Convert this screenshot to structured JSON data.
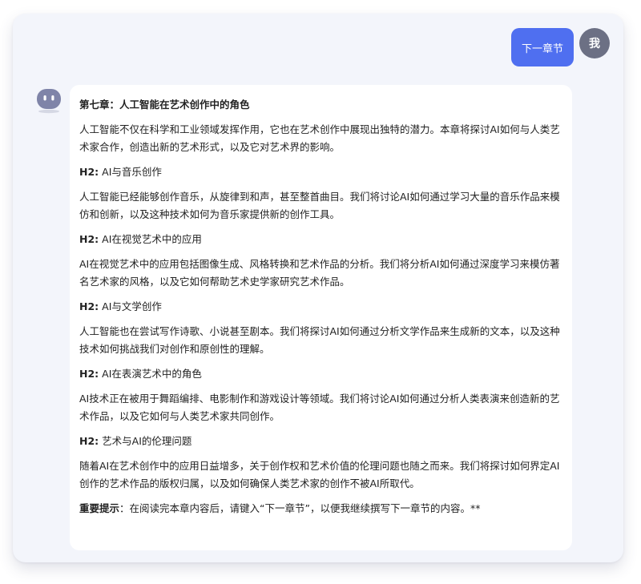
{
  "user": {
    "message": "下一章节",
    "avatar_label": "我"
  },
  "bot": {
    "avatar_icon": "robot-face-icon"
  },
  "reply": {
    "title": "第七章：人工智能在艺术创作中的角色",
    "intro": "人工智能不仅在科学和工业领域发挥作用，它也在艺术创作中展现出独特的潜力。本章将探讨AI如何与人类艺术家合作，创造出新的艺术形式，以及它对艺术界的影响。",
    "sections": [
      {
        "h2_prefix": "H2:",
        "heading": "AI与音乐创作",
        "body": "人工智能已经能够创作音乐，从旋律到和声，甚至整首曲目。我们将讨论AI如何通过学习大量的音乐作品来模仿和创新，以及这种技术如何为音乐家提供新的创作工具。"
      },
      {
        "h2_prefix": "H2:",
        "heading": "AI在视觉艺术中的应用",
        "body": "AI在视觉艺术中的应用包括图像生成、风格转换和艺术作品的分析。我们将分析AI如何通过深度学习来模仿著名艺术家的风格，以及它如何帮助艺术史学家研究艺术作品。"
      },
      {
        "h2_prefix": "H2:",
        "heading": "AI与文学创作",
        "body": "人工智能也在尝试写作诗歌、小说甚至剧本。我们将探讨AI如何通过分析文学作品来生成新的文本，以及这种技术如何挑战我们对创作和原创性的理解。"
      },
      {
        "h2_prefix": "H2:",
        "heading": "AI在表演艺术中的角色",
        "body": "AI技术正在被用于舞蹈编排、电影制作和游戏设计等领域。我们将讨论AI如何通过分析人类表演来创造新的艺术作品，以及它如何与人类艺术家共同创作。"
      },
      {
        "h2_prefix": "H2:",
        "heading": "艺术与AI的伦理问题",
        "body": "随着AI在艺术创作中的应用日益增多，关于创作权和艺术价值的伦理问题也随之而来。我们将探讨如何界定AI创作的艺术作品的版权归属，以及如何确保人类艺术家的创作不被AI所取代。"
      }
    ],
    "tip_label": "重要提示",
    "tip_text": "：在阅读完本章内容后，请键入“下一章节”，以便我继续撰写下一章节的内容。**"
  },
  "colors": {
    "window_bg": "#f3f5fb",
    "user_bubble": "#4f6ff0",
    "user_avatar": "#6c7084",
    "bot_avatar": "#7f84a8",
    "card_bg": "#ffffff",
    "text": "#222222"
  }
}
